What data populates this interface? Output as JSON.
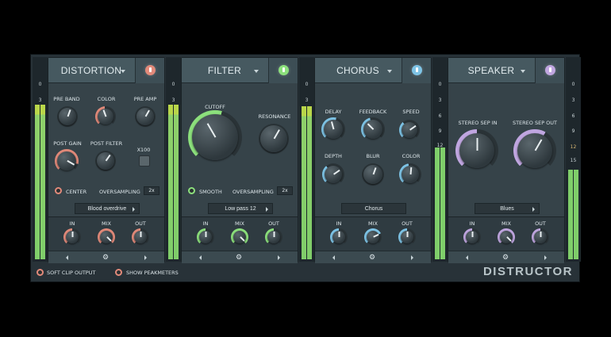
{
  "colors": {
    "accent_distortion": "#e28a7a",
    "accent_filter": "#8ce07c",
    "accent_chorus": "#7ec4e6",
    "accent_speaker": "#c0a6e0",
    "meter_green": "#7fce6a",
    "meter_yellow": "#b9d64a"
  },
  "meters": [
    {
      "labels": [
        "0",
        "3"
      ],
      "level": 0.78
    },
    {
      "labels": [
        "0",
        "3"
      ],
      "level": 0.78
    },
    {
      "labels": [
        "0",
        "3"
      ],
      "level": 0.77
    },
    {
      "labels": [
        "0",
        "3",
        "6",
        "9",
        "12"
      ],
      "level": 0.56
    },
    {
      "labels": [
        "0",
        "3",
        "6",
        "9",
        "12",
        "15"
      ],
      "level": 0.45
    }
  ],
  "distortion": {
    "title": "DISTORTION",
    "knobs": {
      "pre_band": "PRE BAND",
      "color": "COLOR",
      "pre_amp": "PRE AMP",
      "post_gain": "POST GAIN",
      "post_filter": "POST FILTER"
    },
    "x100": "X100",
    "center": "CENTER",
    "oversampling": "OVERSAMPLING",
    "oversampling_value": "2x",
    "preset": "Blood overdrive",
    "mix": {
      "in": "IN",
      "mix": "MIX",
      "out": "OUT"
    }
  },
  "filter": {
    "title": "FILTER",
    "cutoff": "CUTOFF",
    "resonance": "RESONANCE",
    "smooth": "SMOOTH",
    "oversampling": "OVERSAMPLING",
    "oversampling_value": "2x",
    "preset": "Low pass 12",
    "mix": {
      "in": "IN",
      "mix": "MIX",
      "out": "OUT"
    }
  },
  "chorus": {
    "title": "CHORUS",
    "knobs": {
      "delay": "DELAY",
      "feedback": "FEEDBACK",
      "speed": "SPEED",
      "depth": "DEPTH",
      "blur": "BLUR",
      "color": "COLOR"
    },
    "preset": "Chorus",
    "mix": {
      "in": "IN",
      "mix": "MIX",
      "out": "OUT"
    }
  },
  "speaker": {
    "title": "SPEAKER",
    "stereo_in": "STEREO SEP IN",
    "stereo_out": "STEREO SEP OUT",
    "preset": "Blues",
    "mix": {
      "in": "IN",
      "mix": "MIX",
      "out": "OUT"
    }
  },
  "footer": {
    "soft_clip": "SOFT CLIP OUTPUT",
    "show_peak": "SHOW PEAKMETERS",
    "brand": "DISTRUCTOR"
  },
  "icons": {
    "power": "power-icon",
    "dropdown": "chevron-down-icon",
    "gear": "gear-icon",
    "prev": "arrow-left-icon",
    "next": "arrow-right-icon"
  }
}
